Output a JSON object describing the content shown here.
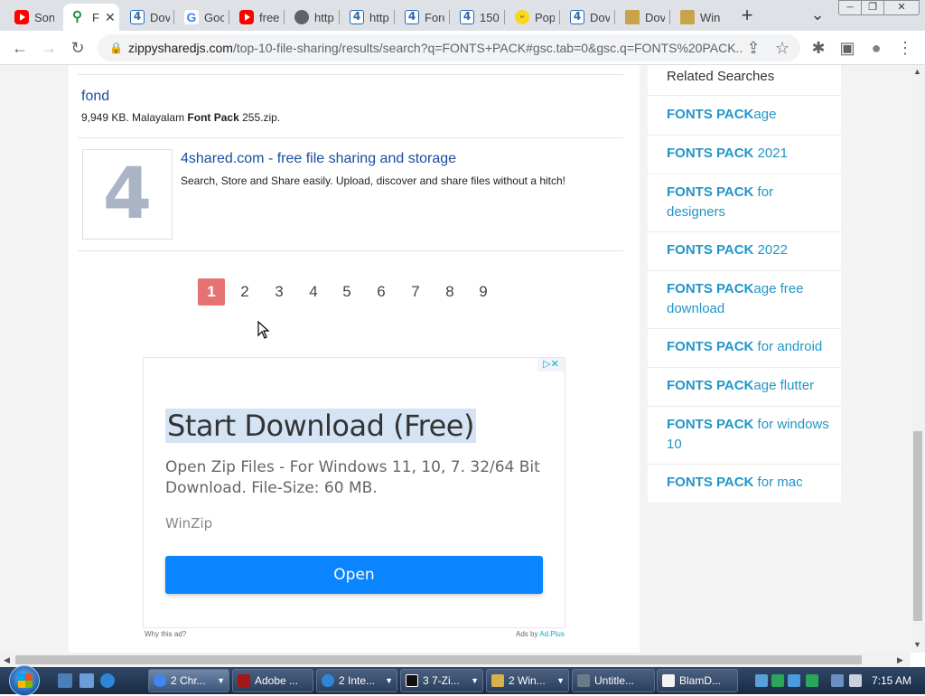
{
  "tabs": [
    {
      "label": "Son",
      "icon": "youtube-icon"
    },
    {
      "label": "F",
      "icon": "search-icon",
      "active": true
    },
    {
      "label": "Dov",
      "icon": "4shared-icon"
    },
    {
      "label": "Goc",
      "icon": "google-icon"
    },
    {
      "label": "free",
      "icon": "youtube-icon"
    },
    {
      "label": "http",
      "icon": "globe-icon"
    },
    {
      "label": "http",
      "icon": "4shared-icon"
    },
    {
      "label": "Forc",
      "icon": "4shared-icon"
    },
    {
      "label": "150",
      "icon": "4shared-icon"
    },
    {
      "label": "Pop",
      "icon": "smile-icon"
    },
    {
      "label": "Dov",
      "icon": "4shared-icon"
    },
    {
      "label": "Dov",
      "icon": "archive-icon"
    },
    {
      "label": "Win",
      "icon": "archive-icon"
    }
  ],
  "tab_glyphs": {
    "new_tab": "+",
    "tab_close": "✕",
    "tab_search": "⌄",
    "minimize": "─",
    "restore": "❐",
    "close": "✕"
  },
  "toolbar": {
    "url_host": "zippysharedjs.com",
    "url_path": "/top-10-file-sharing/results/search?q=FONTS+PACK#gsc.tab=0&gsc.q=FONTS%20PACK...",
    "glyphs": {
      "back": "←",
      "forward": "→",
      "reload": "↻",
      "lock": "🔒",
      "share": "⇪",
      "bookmark": "☆",
      "extensions": "✱",
      "sidepanel": "▣",
      "profile": "●",
      "menu": "⋮"
    }
  },
  "results": [
    {
      "title": "fond",
      "snippet_before": "9,949 KB. Malayalam ",
      "snippet_bold": "Font Pack",
      "snippet_after": " 255.zip."
    },
    {
      "title": "4shared.com - free file sharing and storage",
      "snippet": "Search, Store and Share easily. Upload, discover and share files without a hitch!",
      "thumb_text": "4"
    }
  ],
  "pagination": {
    "current": "1",
    "pages": [
      "1",
      "2",
      "3",
      "4",
      "5",
      "6",
      "7",
      "8",
      "9"
    ]
  },
  "ad": {
    "headline": "Start Download (Free)",
    "text": "Open Zip Files - For Windows 11, 10, 7. 32/64 Bit Download. File-Size: 60 MB.",
    "advertiser": "WinZip",
    "button": "Open",
    "why_label": "Why this ad?",
    "ads_by": "Ads by",
    "ads_by_link": "Ad.Plus",
    "adchoices": "▷✕"
  },
  "sidebar": {
    "heading": "Related Searches",
    "items": [
      {
        "bold": "FONTS PACK",
        "rest": "age"
      },
      {
        "bold": "FONTS PACK",
        "rest": " 2021"
      },
      {
        "bold": "FONTS PACK",
        "rest": " for designers"
      },
      {
        "bold": "FONTS PACK",
        "rest": " 2022"
      },
      {
        "bold": "FONTS PACK",
        "rest": "age free download"
      },
      {
        "bold": "FONTS PACK",
        "rest": " for android"
      },
      {
        "bold": "FONTS PACK",
        "rest": "age flutter"
      },
      {
        "bold": "FONTS PACK",
        "rest": " for windows 10"
      },
      {
        "bold": "FONTS PACK",
        "rest": " for mac"
      }
    ]
  },
  "taskbar": {
    "tasks": [
      {
        "label": "2 Chr...",
        "icon": "chrome-icon",
        "active": true
      },
      {
        "label": "Adobe ...",
        "icon": "flash-icon"
      },
      {
        "label": "2 Inte...",
        "icon": "ie-icon"
      },
      {
        "label": "3 7-Zi...",
        "icon": "7zip-icon"
      },
      {
        "label": "2 Win...",
        "icon": "winzip-icon"
      },
      {
        "label": "Untitle...",
        "icon": "app-icon"
      },
      {
        "label": "BlamD...",
        "icon": "doc-icon"
      }
    ],
    "clock": "7:15 AM"
  },
  "colors": {
    "link": "#1a4c9c",
    "related_link": "#2196c7",
    "current_page": "#e57373",
    "ad_button": "#0a84ff"
  }
}
